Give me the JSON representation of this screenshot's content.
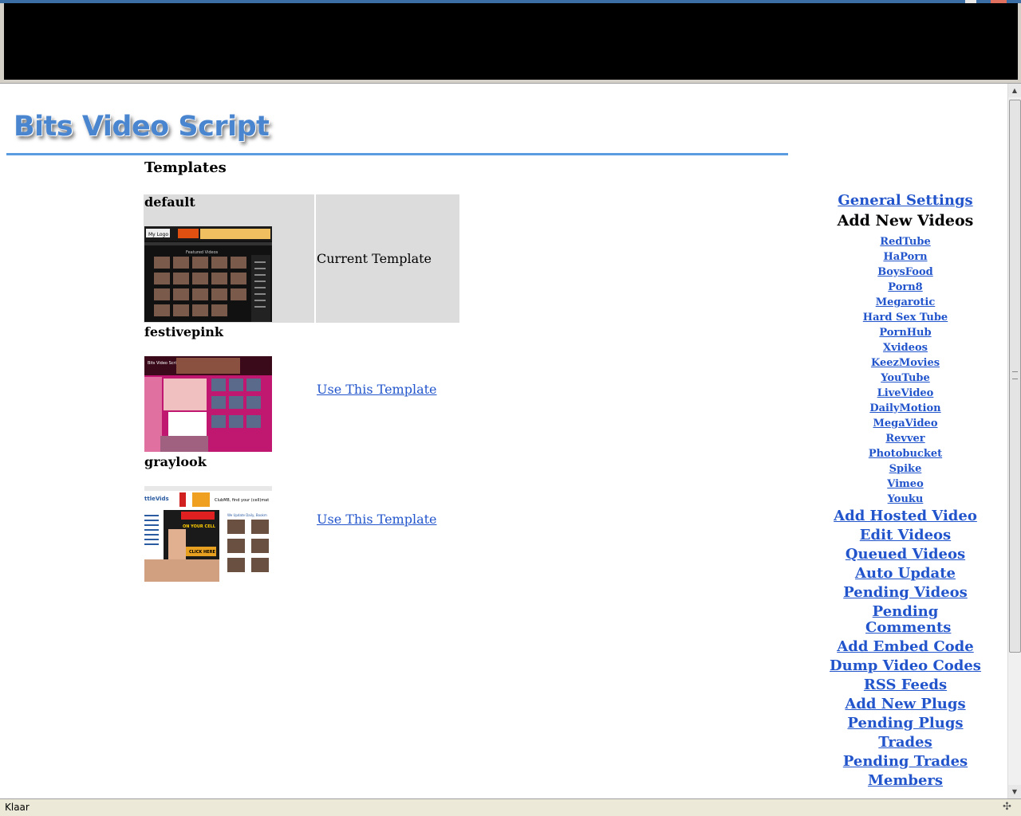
{
  "app": {
    "logo_text": "Bits Video Script",
    "status_text": "Klaar"
  },
  "page": {
    "heading": "Templates"
  },
  "templates": [
    {
      "name": "default",
      "status": "Current Template"
    },
    {
      "name": "festivepink",
      "action": "Use This Template"
    },
    {
      "name": "graylook",
      "action": "Use This Template"
    }
  ],
  "thumbnail_labels": {
    "default_logo": "My Logo",
    "default_section": "Featured Videos",
    "festivepink_logo": "Bits Video Script",
    "graylook_brand": "ttleVids",
    "graylook_ad": "ClubM8, find your (cell)mat",
    "graylook_update": "We Update Daily, Bookm",
    "graylook_banner": "ON YOUR CELL",
    "graylook_button": "CLICK HERE"
  },
  "sidebar": {
    "general_settings": "General Settings",
    "add_new_videos_heading": "Add New Videos",
    "sources": [
      "RedTube",
      "HaPorn",
      "BoysFood",
      "Porn8",
      "Megarotic",
      "Hard Sex Tube",
      "PornHub",
      "Xvideos",
      "KeezMovies",
      "YouTube",
      "LiveVideo",
      "DailyMotion",
      "MegaVideo",
      "Revver",
      "Photobucket",
      "Spike",
      "Vimeo",
      "Youku"
    ],
    "actions": [
      "Add Hosted Video",
      "Edit Videos",
      "Queued Videos",
      "Auto Update",
      "Pending Videos",
      "Pending Comments",
      "Add Embed Code",
      "Dump Video Codes",
      "RSS Feeds",
      "Add New Plugs",
      "Pending Plugs",
      "Trades",
      "Pending Trades",
      "Members"
    ]
  },
  "colors": {
    "link": "#2255cc",
    "header_rule": "#5b9be0",
    "cell_bg": "#dcdcdc",
    "logo": "#4a86d0"
  }
}
